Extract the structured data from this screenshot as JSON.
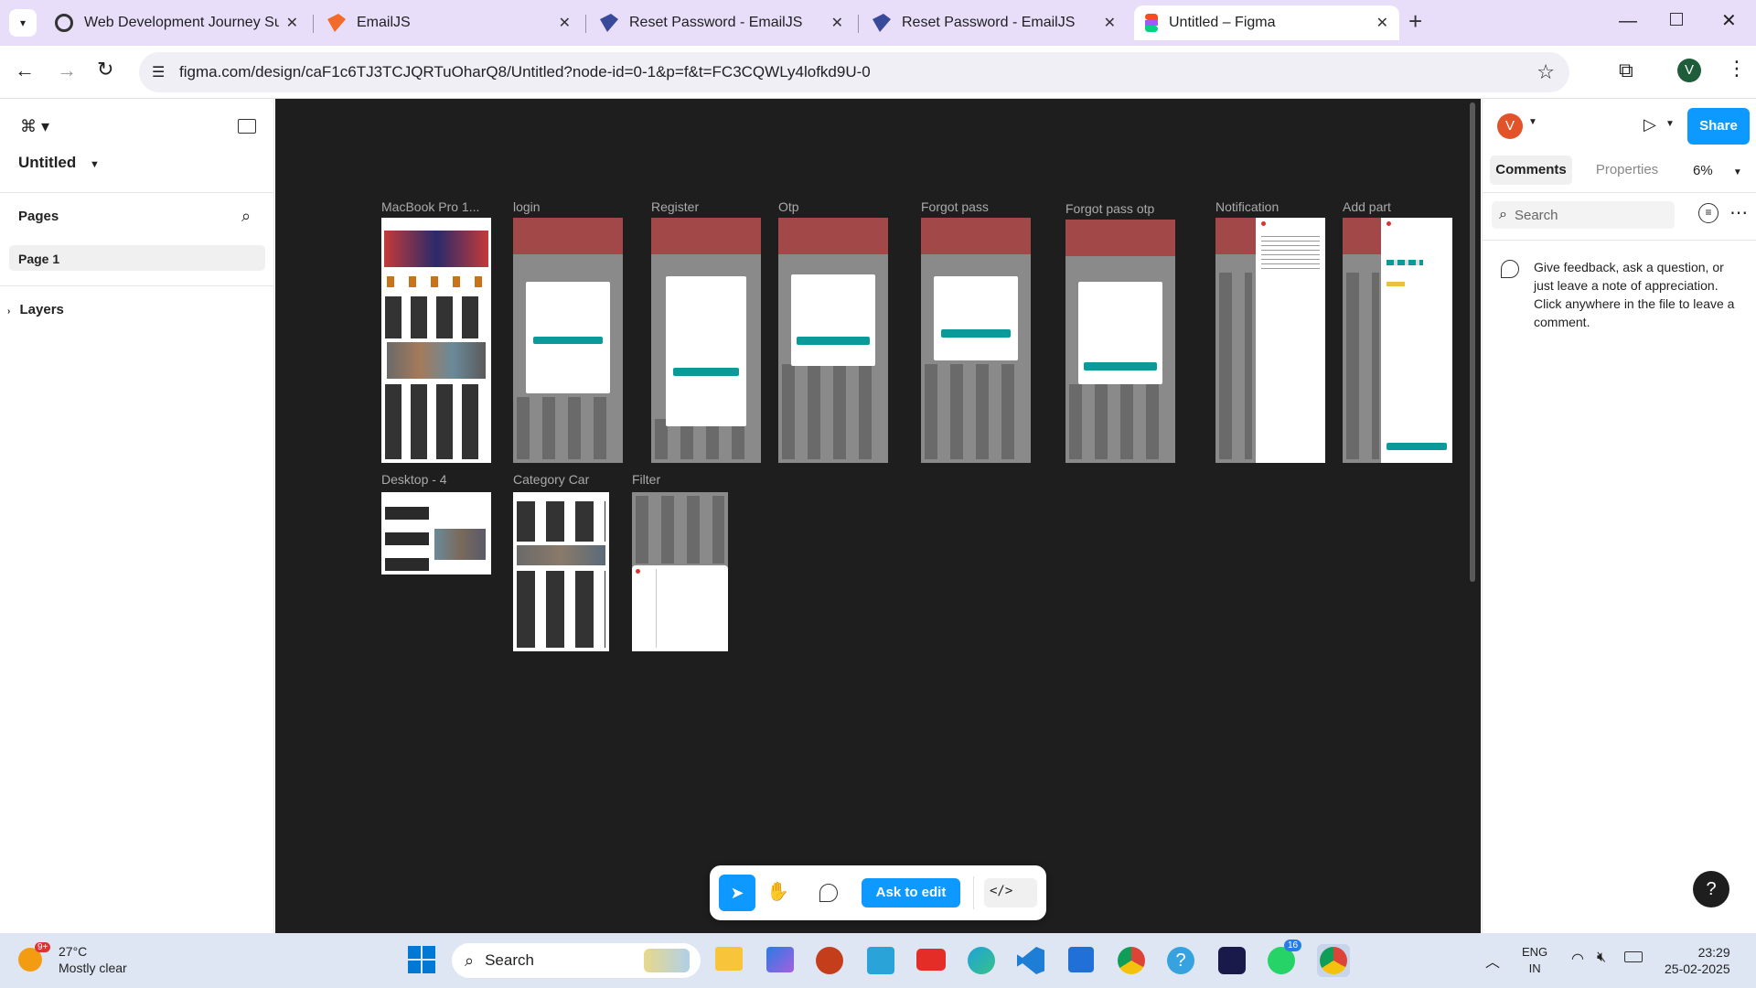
{
  "tabs": [
    {
      "title": "Web Development Journey Sum",
      "active": false
    },
    {
      "title": "EmailJS",
      "active": false
    },
    {
      "title": "Reset Password - EmailJS",
      "active": false
    },
    {
      "title": "Reset Password - EmailJS",
      "active": false
    },
    {
      "title": "Untitled – Figma",
      "active": true
    }
  ],
  "browser": {
    "url": "figma.com/design/caF1c6TJ3TCJQRTuOharQ8/Untitled?node-id=0-1&p=f&t=FC3CQWLy4lofkd9U-0",
    "profile_initial": "V"
  },
  "left": {
    "file_name": "Untitled",
    "pages_label": "Pages",
    "page1": "Page 1",
    "layers_label": "Layers"
  },
  "frames": {
    "macbook": "MacBook Pro 1...",
    "login": "login",
    "register": "Register",
    "otp": "Otp",
    "forgot": "Forgot pass",
    "forgot_otp": "Forgot pass otp",
    "notification": "Notification",
    "add_part": "Add part",
    "desktop4": "Desktop - 4",
    "category": "Category Car",
    "filter": "Filter"
  },
  "right": {
    "avatar": "V",
    "share": "Share",
    "tab_comments": "Comments",
    "tab_properties": "Properties",
    "zoom": "6%",
    "search_placeholder": "Search",
    "hint": "Give feedback, ask a question, or just leave a note of appreciation. Click anywhere in the file to leave a comment."
  },
  "bottom": {
    "ask_to_edit": "Ask to edit"
  },
  "taskbar": {
    "temp": "27°C",
    "weather": "Mostly clear",
    "weather_badge": "9+",
    "search": "Search",
    "lang1": "ENG",
    "lang2": "IN",
    "time": "23:29",
    "date": "25-02-2025",
    "wa_badge": "16"
  },
  "colors": {
    "accent": "#0d99ff",
    "tabbar": "#e8defa",
    "canvas": "#1e1e1e"
  }
}
